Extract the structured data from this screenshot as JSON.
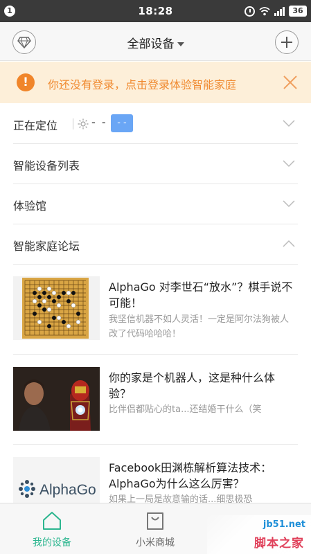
{
  "status_bar": {
    "notification_count": "1",
    "time": "18:28",
    "battery": "36",
    "icons": [
      "alarm-icon",
      "wifi-icon",
      "signal-icon",
      "battery-icon"
    ]
  },
  "header": {
    "title": "全部设备",
    "left_icon": "diamond-icon",
    "right_icon": "plus-icon"
  },
  "banner": {
    "text": "你还没有登录，点击登录体验智能家庭",
    "icon": "warning-icon",
    "close_icon": "close-icon"
  },
  "sections": {
    "locating": {
      "label": "正在定位",
      "weather": "- -",
      "chip": "- -"
    },
    "device_list": {
      "label": "智能设备列表"
    },
    "experience": {
      "label": "体验馆"
    },
    "forum": {
      "label": "智能家庭论坛"
    }
  },
  "articles": [
    {
      "title": "AlphaGo 对李世石“放水”？棋手说不可能！",
      "desc": "我坚信机器不如人灵活！一定是阿尔法狗被人改了代码哈哈哈！",
      "thumb": "go-board-image"
    },
    {
      "title": "你的家是个机器人，这是种什么体验？",
      "desc": "比伴侣都贴心的ta...还结婚干什么（笑",
      "thumb": "iron-man-image"
    },
    {
      "title": "Facebook田渊栋解析算法技术：AlphaGo为什么这么厉害？",
      "desc": "如果上一局是故意输的话...细思极恐",
      "thumb": "alphago-logo-image",
      "logo_text": "AlphaGo"
    }
  ],
  "tabbar": {
    "tabs": [
      {
        "label": "我的设备",
        "icon": "home-icon",
        "active": true
      },
      {
        "label": "小米商城",
        "icon": "shopping-bag-icon",
        "active": false
      }
    ]
  },
  "watermark": {
    "url": "jb51.net",
    "site": "脚本之家"
  },
  "colors": {
    "accent": "#2cb68f",
    "warning": "#f0852a",
    "banner_bg": "#fdefd9",
    "chip": "#6aa6f5"
  }
}
